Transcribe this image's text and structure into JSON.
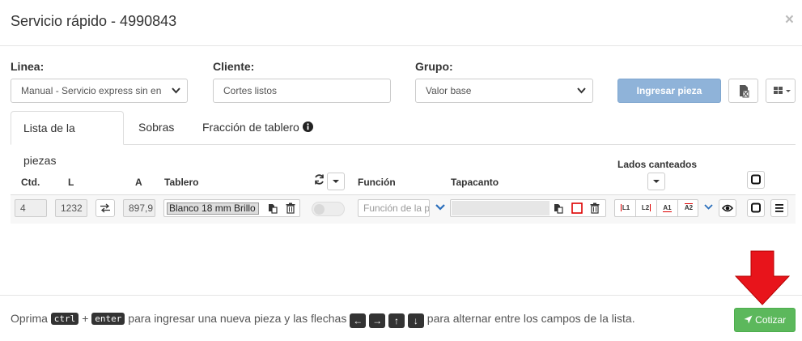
{
  "modal": {
    "title": "Servicio rápido - 4990843",
    "close": "×"
  },
  "form": {
    "linea": {
      "label": "Linea:",
      "value": "Manual - Servicio express sin en"
    },
    "cliente": {
      "label": "Cliente:",
      "value": "Cortes listos"
    },
    "grupo": {
      "label": "Grupo:",
      "value": "Valor base"
    },
    "ingresar_label": "Ingresar pieza"
  },
  "tabs": [
    {
      "label": "Lista de la piezas"
    },
    {
      "label": "Sobras"
    },
    {
      "label": "Fracción de tablero"
    }
  ],
  "table": {
    "headers": {
      "ctd": "Ctd.",
      "l": "L",
      "a": "A",
      "tablero": "Tablero",
      "funcion": "Función",
      "tapacanto": "Tapacanto",
      "lados": "Lados canteados"
    },
    "row": {
      "ctd": "4",
      "l": "1232",
      "a": "897,9",
      "tablero": "Blanco 18 mm Brillo",
      "funcion_placeholder": "Función de la p",
      "tapacanto": "",
      "edges": [
        "L1",
        "L2",
        "A1",
        "A2"
      ]
    }
  },
  "footer": {
    "oprima": "Oprima",
    "key_ctrl": "ctrl",
    "plus": "+",
    "key_enter": "enter",
    "mid": "para ingresar una nueva pieza y las flechas",
    "end": "para alternar entre los campos de la lista.",
    "cotizar_label": "Cotizar"
  },
  "colors": {
    "primary": "#8fb3d9",
    "success": "#5cb85c",
    "annotation": "#e8141b"
  }
}
